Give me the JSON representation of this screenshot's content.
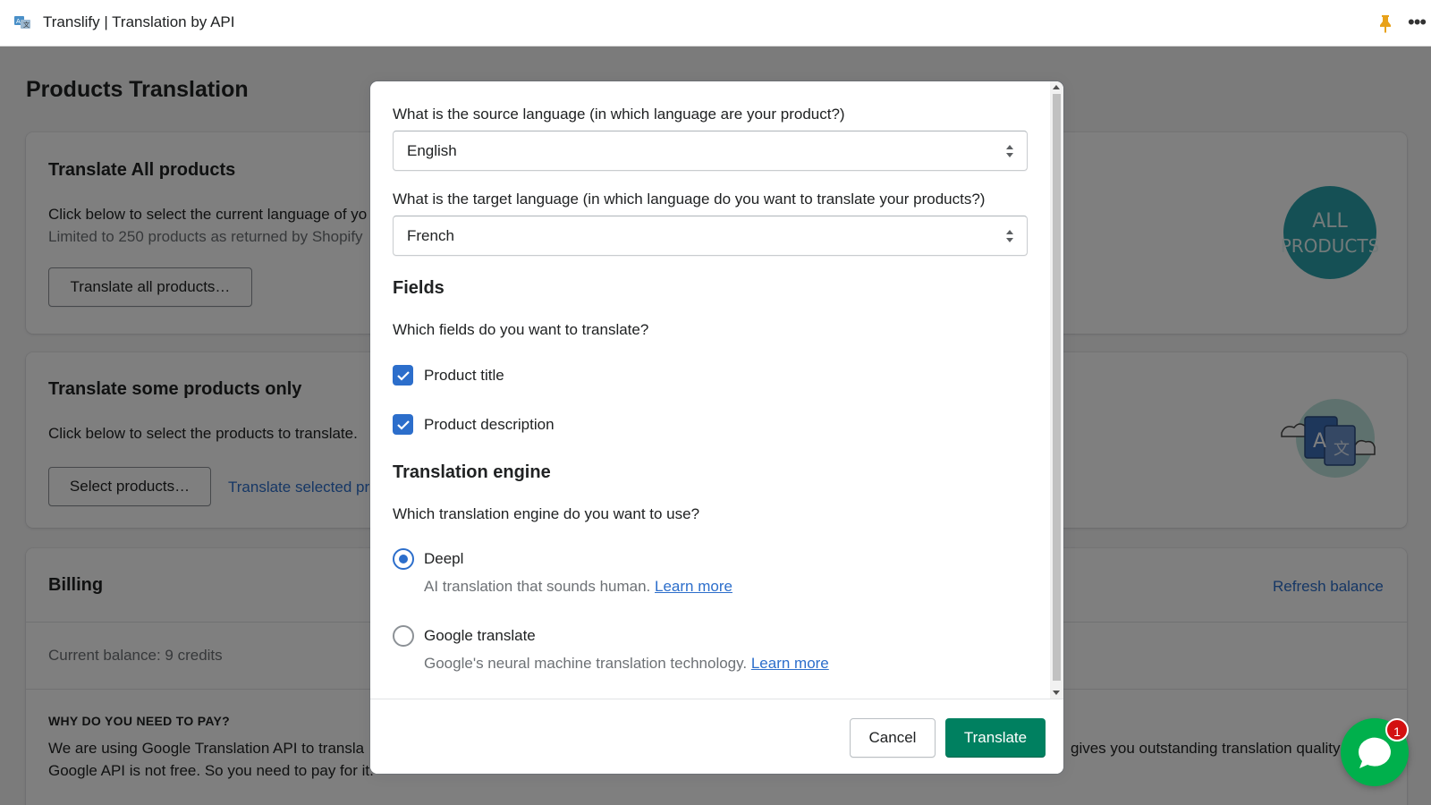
{
  "app": {
    "title": "Translify | Translation by API"
  },
  "page": {
    "title": "Products Translation",
    "translate_all": {
      "heading": "Translate All products",
      "description": "Click below to select the current language of yo",
      "limit_text": "Limited to 250 products as returned by Shopify",
      "button": "Translate all products…",
      "image_text_line1": "ALL",
      "image_text_line2": "PRODUCTS"
    },
    "translate_some": {
      "heading": "Translate some products only",
      "description": "Click below to select the products to translate.",
      "select_button": "Select products…",
      "translate_link": "Translate selected pr"
    },
    "billing": {
      "heading": "Billing",
      "refresh_link": "Refresh balance",
      "balance": "Current balance: 9 credits",
      "why_title": "WHY DO YOU NEED TO PAY?",
      "why_text_left": "We are using Google Translation API to transla",
      "why_text_right": "gives you outstanding translation quality",
      "why_text_line2": "Google API is not free. So you need to pay for it."
    }
  },
  "modal": {
    "source_label": "What is the source language (in which language are your product?)",
    "source_value": "English",
    "target_label": "What is the target language (in which language do you want to translate your products?)",
    "target_value": "French",
    "fields_title": "Fields",
    "fields_question": "Which fields do you want to translate?",
    "field_options": [
      {
        "label": "Product title",
        "checked": true
      },
      {
        "label": "Product description",
        "checked": true
      }
    ],
    "engine_title": "Translation engine",
    "engine_question": "Which translation engine do you want to use?",
    "engines": [
      {
        "label": "Deepl",
        "help": "AI translation that sounds human.",
        "link": "Learn more",
        "selected": true
      },
      {
        "label": "Google translate",
        "help": "Google's neural machine translation technology.",
        "link": "Learn more",
        "selected": false
      }
    ],
    "cancel_label": "Cancel",
    "translate_label": "Translate"
  },
  "chat": {
    "badge_count": "1"
  },
  "colors": {
    "primary": "#008060",
    "link": "#2c6ecb",
    "chat": "#00b04c",
    "badge": "#d31111"
  }
}
